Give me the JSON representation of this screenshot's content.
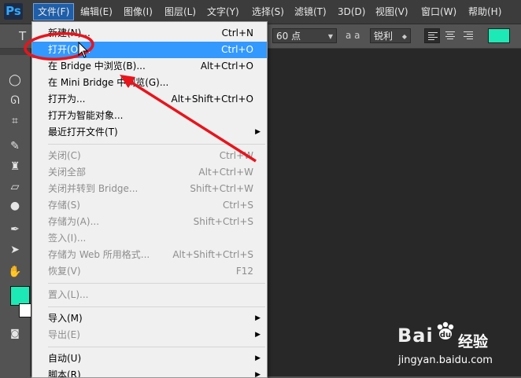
{
  "app": {
    "logo": "Ps"
  },
  "menubar": {
    "items": [
      {
        "label": "文件(F)"
      },
      {
        "label": "编辑(E)"
      },
      {
        "label": "图像(I)"
      },
      {
        "label": "图层(L)"
      },
      {
        "label": "文字(Y)"
      },
      {
        "label": "选择(S)"
      },
      {
        "label": "滤镜(T)"
      },
      {
        "label": "3D(D)"
      },
      {
        "label": "视图(V)"
      },
      {
        "label": "窗口(W)"
      },
      {
        "label": "帮助(H)"
      }
    ]
  },
  "options": {
    "tool_letter": "T",
    "font_size": "60 点",
    "aa_icon": "a a",
    "antialias": "锐利",
    "text_color": "#1de9b6"
  },
  "file_menu": {
    "items": [
      {
        "label": "新建(N)...",
        "shortcut": "Ctrl+N"
      },
      {
        "label": "打开(O)...",
        "shortcut": "Ctrl+O"
      },
      {
        "label": "在 Bridge 中浏览(B)...",
        "shortcut": "Alt+Ctrl+O"
      },
      {
        "label": "在 Mini Bridge 中浏览(G)...",
        "shortcut": ""
      },
      {
        "label": "打开为...",
        "shortcut": "Alt+Shift+Ctrl+O"
      },
      {
        "label": "打开为智能对象...",
        "shortcut": ""
      },
      {
        "label": "最近打开文件(T)",
        "shortcut": ""
      },
      {
        "label": "关闭(C)",
        "shortcut": "Ctrl+W"
      },
      {
        "label": "关闭全部",
        "shortcut": "Alt+Ctrl+W"
      },
      {
        "label": "关闭并转到 Bridge...",
        "shortcut": "Shift+Ctrl+W"
      },
      {
        "label": "存储(S)",
        "shortcut": "Ctrl+S"
      },
      {
        "label": "存储为(A)...",
        "shortcut": "Shift+Ctrl+S"
      },
      {
        "label": "签入(I)...",
        "shortcut": ""
      },
      {
        "label": "存储为 Web 所用格式...",
        "shortcut": "Alt+Shift+Ctrl+S"
      },
      {
        "label": "恢复(V)",
        "shortcut": "F12"
      },
      {
        "label": "置入(L)...",
        "shortcut": ""
      },
      {
        "label": "导入(M)",
        "shortcut": ""
      },
      {
        "label": "导出(E)",
        "shortcut": ""
      },
      {
        "label": "自动(U)",
        "shortcut": ""
      },
      {
        "label": "脚本(R)",
        "shortcut": ""
      }
    ]
  },
  "toolbar": {
    "foreground_color": "#1de9b6",
    "background_color": "#ffffff"
  },
  "watermark": {
    "brand_a": "Bai",
    "brand_b": "du",
    "brand_c": "经验",
    "url": "jingyan.baidu.com"
  },
  "annotation": {
    "color": "#e8141c"
  }
}
